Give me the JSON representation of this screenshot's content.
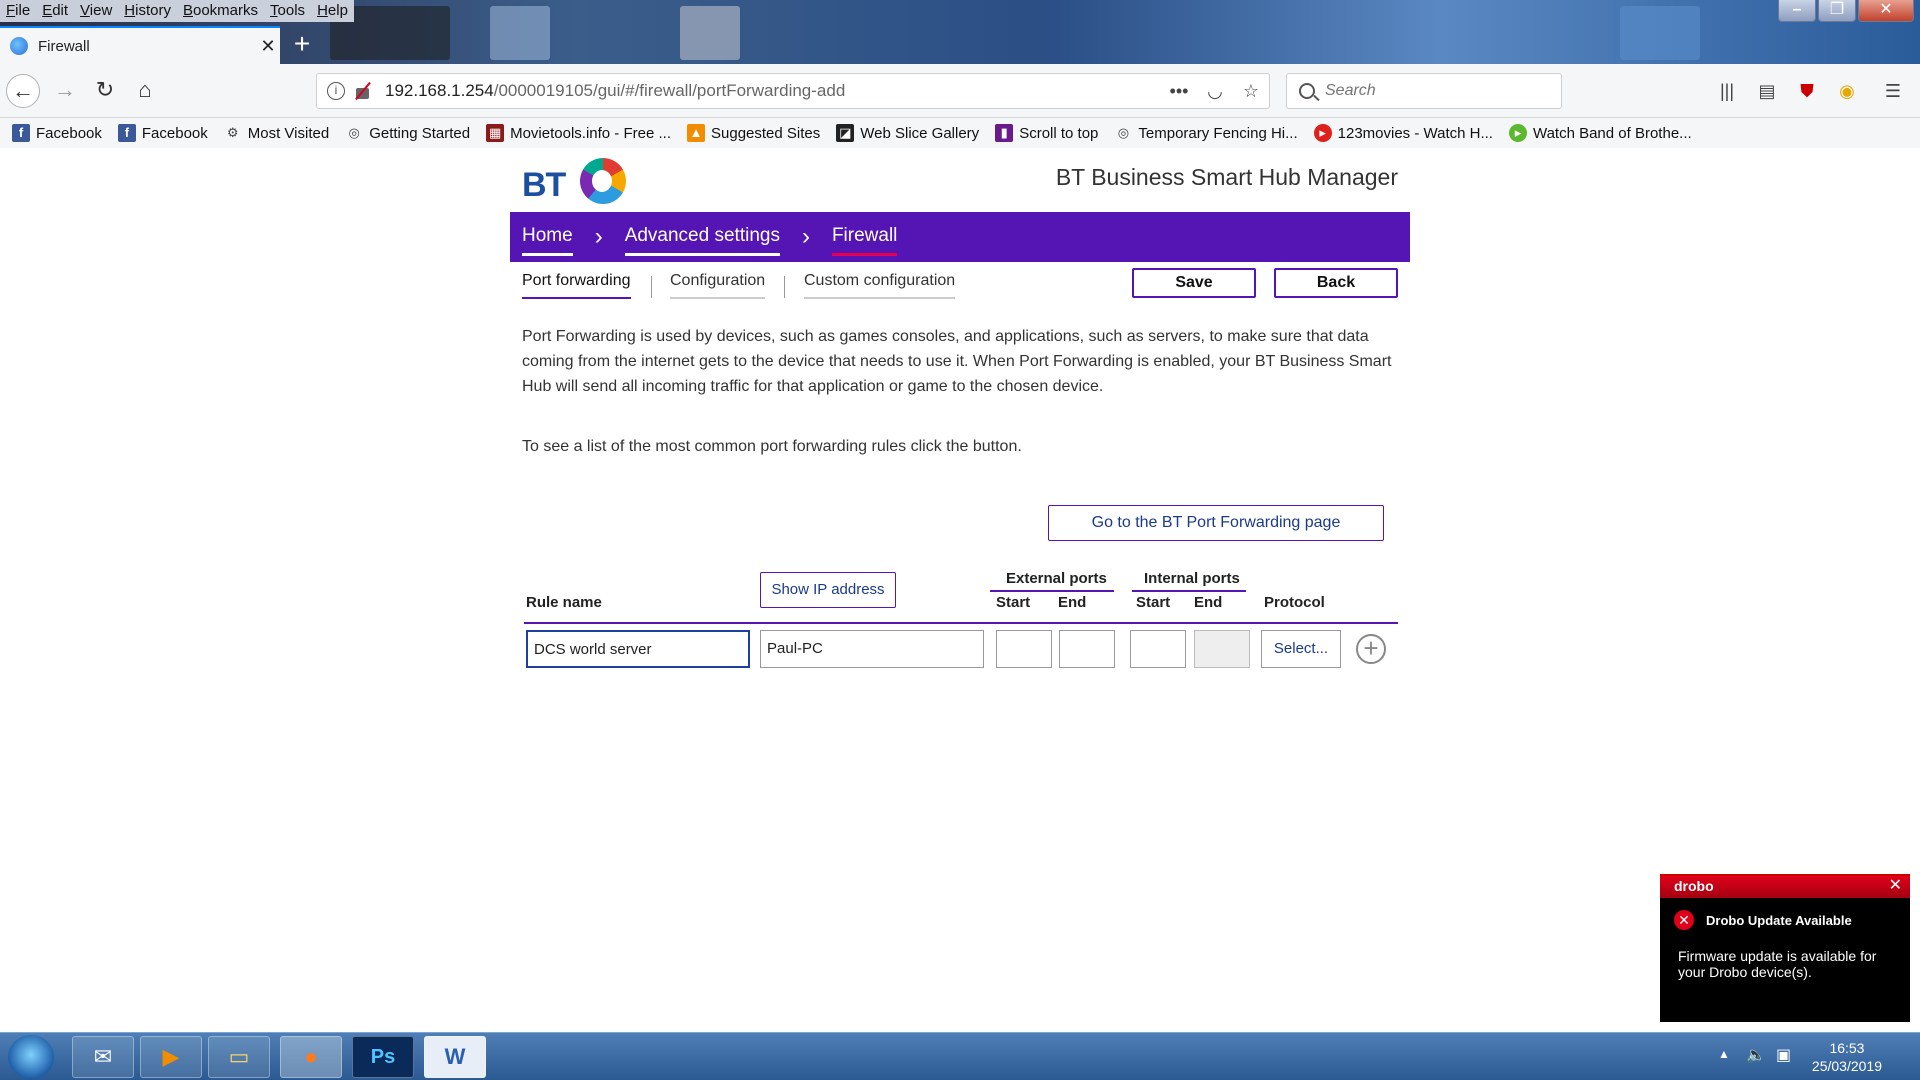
{
  "browser": {
    "menu": [
      "File",
      "Edit",
      "View",
      "History",
      "Bookmarks",
      "Tools",
      "Help"
    ],
    "tab_title": "Firewall",
    "url_host": "192.168.1.254",
    "url_path": "/0000019105/gui/#/firewall/portForwarding-add",
    "search_placeholder": "Search",
    "bookmarks": [
      {
        "label": "Facebook",
        "icon": "facebook-icon",
        "color": "#3b5998"
      },
      {
        "label": "Facebook",
        "icon": "facebook-icon",
        "color": "#3b5998"
      },
      {
        "label": "Most Visited",
        "icon": "gear-icon",
        "color": "#444444"
      },
      {
        "label": "Getting Started",
        "icon": "globe-icon",
        "color": "#444444"
      },
      {
        "label": "Movietools.info - Free ...",
        "icon": "movietools-icon",
        "color": "#8b1a1a"
      },
      {
        "label": "Suggested Sites",
        "icon": "suggested-sites-icon",
        "color": "#f28c00"
      },
      {
        "label": "Web Slice Gallery",
        "icon": "web-slice-icon",
        "color": "#222222"
      },
      {
        "label": "Scroll to top",
        "icon": "scroll-top-icon",
        "color": "#6a1a8a"
      },
      {
        "label": "Temporary Fencing Hi...",
        "icon": "globe-icon",
        "color": "#444444"
      },
      {
        "label": "123movies - Watch H...",
        "icon": "play-icon",
        "color": "#e0201a"
      },
      {
        "label": "Watch Band of Brothe...",
        "icon": "play-icon",
        "color": "#5cb82e"
      }
    ]
  },
  "hub": {
    "brand": "BT",
    "title": "BT Business Smart Hub Manager",
    "breadcrumbs": [
      "Home",
      "Advanced settings",
      "Firewall"
    ],
    "subtabs": [
      "Port forwarding",
      "Configuration",
      "Custom configuration"
    ],
    "save_label": "Save",
    "back_label": "Back",
    "intro": "Port Forwarding is used by devices, such as games consoles, and applications, such as servers, to make sure that data coming from the internet gets to the device that needs to use it. When Port Forwarding is enabled, your BT Business Smart Hub will send all incoming traffic for that application or game to the chosen device.",
    "common_note": "To see a list of the most common port forwarding rules click the button.",
    "bt_pf_button": "Go to the BT Port Forwarding page",
    "table": {
      "rule_name_header": "Rule name",
      "show_ip_label": "Show IP address",
      "external_ports_header": "External ports",
      "internal_ports_header": "Internal ports",
      "start_header": "Start",
      "end_header": "End",
      "protocol_header": "Protocol",
      "row": {
        "rule_name": "DCS world server",
        "device": "Paul-PC",
        "ext_start": "",
        "ext_end": "",
        "int_start": "",
        "int_end": "",
        "protocol": "Select..."
      }
    }
  },
  "drobo": {
    "brand": "drobo",
    "title": "Drobo Update Available",
    "body": "Firmware update is available for your Drobo device(s)."
  },
  "taskbar": {
    "time": "16:53",
    "date": "25/03/2019"
  },
  "colors": {
    "bt_purple": "#5514b4",
    "active_underline": "#e60050",
    "drobo_red": "#e0001a"
  }
}
